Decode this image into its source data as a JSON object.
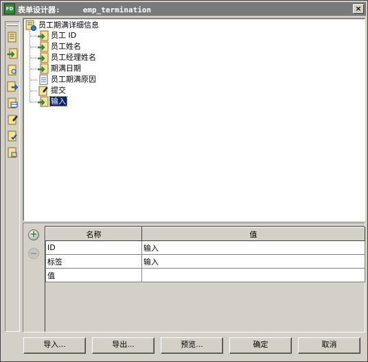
{
  "window": {
    "title": "表单设计器:     emp_termination",
    "icon_text": "FD",
    "close_glyph": "×"
  },
  "toolbar": {
    "buttons": [
      "form-field-icon",
      "insert-field-icon",
      "search-field-icon",
      "export-field-icon",
      "table-field-icon",
      "edit-field-icon",
      "checklist-field-icon",
      "settings-field-icon"
    ]
  },
  "tree": {
    "root": "员工期满详细信息",
    "items": [
      {
        "label": "员工 ID",
        "icon": "field-arrow-icon"
      },
      {
        "label": "员工姓名",
        "icon": "field-arrow-icon"
      },
      {
        "label": "员工经理姓名",
        "icon": "field-arrow-icon"
      },
      {
        "label": "期满日期",
        "icon": "field-arrow-icon"
      },
      {
        "label": "员工期满原因",
        "icon": "field-doc-icon"
      },
      {
        "label": "提交",
        "icon": "submit-icon"
      },
      {
        "label": "输入",
        "icon": "field-arrow-icon",
        "selected": true
      }
    ]
  },
  "properties": {
    "add_glyph": "+",
    "columns": [
      "名称",
      "值"
    ],
    "rows": [
      [
        "ID",
        "输入"
      ],
      [
        "标签",
        "输入"
      ],
      [
        "值",
        ""
      ]
    ]
  },
  "buttons": {
    "import": "导入...",
    "export": "导出...",
    "preview": "预览...",
    "ok": "确定",
    "cancel": "取消"
  },
  "colors": {
    "selection": "#0a246a",
    "face": "#d4d0c8",
    "titlebar": "#7a7a7a"
  }
}
